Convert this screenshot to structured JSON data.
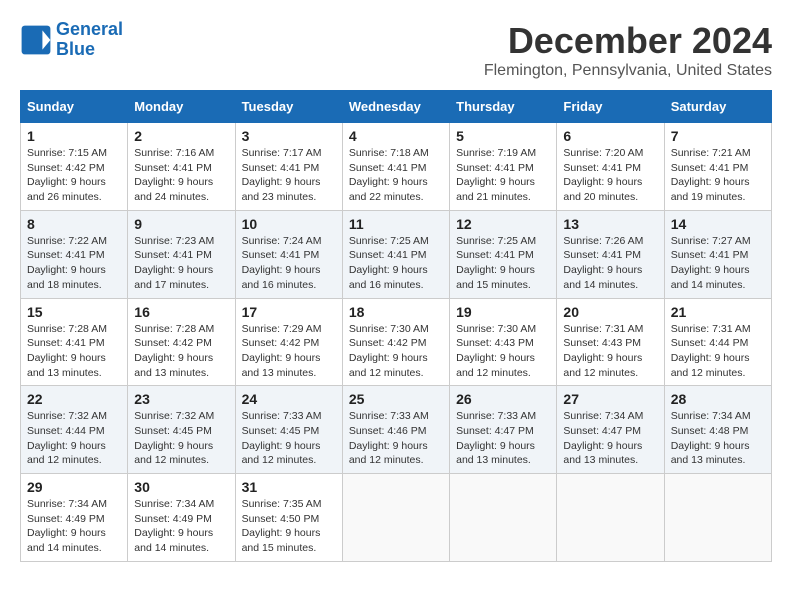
{
  "header": {
    "logo_line1": "General",
    "logo_line2": "Blue",
    "month_year": "December 2024",
    "location": "Flemington, Pennsylvania, United States"
  },
  "weekdays": [
    "Sunday",
    "Monday",
    "Tuesday",
    "Wednesday",
    "Thursday",
    "Friday",
    "Saturday"
  ],
  "weeks": [
    [
      {
        "day": "1",
        "sunrise": "Sunrise: 7:15 AM",
        "sunset": "Sunset: 4:42 PM",
        "daylight": "Daylight: 9 hours and 26 minutes."
      },
      {
        "day": "2",
        "sunrise": "Sunrise: 7:16 AM",
        "sunset": "Sunset: 4:41 PM",
        "daylight": "Daylight: 9 hours and 24 minutes."
      },
      {
        "day": "3",
        "sunrise": "Sunrise: 7:17 AM",
        "sunset": "Sunset: 4:41 PM",
        "daylight": "Daylight: 9 hours and 23 minutes."
      },
      {
        "day": "4",
        "sunrise": "Sunrise: 7:18 AM",
        "sunset": "Sunset: 4:41 PM",
        "daylight": "Daylight: 9 hours and 22 minutes."
      },
      {
        "day": "5",
        "sunrise": "Sunrise: 7:19 AM",
        "sunset": "Sunset: 4:41 PM",
        "daylight": "Daylight: 9 hours and 21 minutes."
      },
      {
        "day": "6",
        "sunrise": "Sunrise: 7:20 AM",
        "sunset": "Sunset: 4:41 PM",
        "daylight": "Daylight: 9 hours and 20 minutes."
      },
      {
        "day": "7",
        "sunrise": "Sunrise: 7:21 AM",
        "sunset": "Sunset: 4:41 PM",
        "daylight": "Daylight: 9 hours and 19 minutes."
      }
    ],
    [
      {
        "day": "8",
        "sunrise": "Sunrise: 7:22 AM",
        "sunset": "Sunset: 4:41 PM",
        "daylight": "Daylight: 9 hours and 18 minutes."
      },
      {
        "day": "9",
        "sunrise": "Sunrise: 7:23 AM",
        "sunset": "Sunset: 4:41 PM",
        "daylight": "Daylight: 9 hours and 17 minutes."
      },
      {
        "day": "10",
        "sunrise": "Sunrise: 7:24 AM",
        "sunset": "Sunset: 4:41 PM",
        "daylight": "Daylight: 9 hours and 16 minutes."
      },
      {
        "day": "11",
        "sunrise": "Sunrise: 7:25 AM",
        "sunset": "Sunset: 4:41 PM",
        "daylight": "Daylight: 9 hours and 16 minutes."
      },
      {
        "day": "12",
        "sunrise": "Sunrise: 7:25 AM",
        "sunset": "Sunset: 4:41 PM",
        "daylight": "Daylight: 9 hours and 15 minutes."
      },
      {
        "day": "13",
        "sunrise": "Sunrise: 7:26 AM",
        "sunset": "Sunset: 4:41 PM",
        "daylight": "Daylight: 9 hours and 14 minutes."
      },
      {
        "day": "14",
        "sunrise": "Sunrise: 7:27 AM",
        "sunset": "Sunset: 4:41 PM",
        "daylight": "Daylight: 9 hours and 14 minutes."
      }
    ],
    [
      {
        "day": "15",
        "sunrise": "Sunrise: 7:28 AM",
        "sunset": "Sunset: 4:41 PM",
        "daylight": "Daylight: 9 hours and 13 minutes."
      },
      {
        "day": "16",
        "sunrise": "Sunrise: 7:28 AM",
        "sunset": "Sunset: 4:42 PM",
        "daylight": "Daylight: 9 hours and 13 minutes."
      },
      {
        "day": "17",
        "sunrise": "Sunrise: 7:29 AM",
        "sunset": "Sunset: 4:42 PM",
        "daylight": "Daylight: 9 hours and 13 minutes."
      },
      {
        "day": "18",
        "sunrise": "Sunrise: 7:30 AM",
        "sunset": "Sunset: 4:42 PM",
        "daylight": "Daylight: 9 hours and 12 minutes."
      },
      {
        "day": "19",
        "sunrise": "Sunrise: 7:30 AM",
        "sunset": "Sunset: 4:43 PM",
        "daylight": "Daylight: 9 hours and 12 minutes."
      },
      {
        "day": "20",
        "sunrise": "Sunrise: 7:31 AM",
        "sunset": "Sunset: 4:43 PM",
        "daylight": "Daylight: 9 hours and 12 minutes."
      },
      {
        "day": "21",
        "sunrise": "Sunrise: 7:31 AM",
        "sunset": "Sunset: 4:44 PM",
        "daylight": "Daylight: 9 hours and 12 minutes."
      }
    ],
    [
      {
        "day": "22",
        "sunrise": "Sunrise: 7:32 AM",
        "sunset": "Sunset: 4:44 PM",
        "daylight": "Daylight: 9 hours and 12 minutes."
      },
      {
        "day": "23",
        "sunrise": "Sunrise: 7:32 AM",
        "sunset": "Sunset: 4:45 PM",
        "daylight": "Daylight: 9 hours and 12 minutes."
      },
      {
        "day": "24",
        "sunrise": "Sunrise: 7:33 AM",
        "sunset": "Sunset: 4:45 PM",
        "daylight": "Daylight: 9 hours and 12 minutes."
      },
      {
        "day": "25",
        "sunrise": "Sunrise: 7:33 AM",
        "sunset": "Sunset: 4:46 PM",
        "daylight": "Daylight: 9 hours and 12 minutes."
      },
      {
        "day": "26",
        "sunrise": "Sunrise: 7:33 AM",
        "sunset": "Sunset: 4:47 PM",
        "daylight": "Daylight: 9 hours and 13 minutes."
      },
      {
        "day": "27",
        "sunrise": "Sunrise: 7:34 AM",
        "sunset": "Sunset: 4:47 PM",
        "daylight": "Daylight: 9 hours and 13 minutes."
      },
      {
        "day": "28",
        "sunrise": "Sunrise: 7:34 AM",
        "sunset": "Sunset: 4:48 PM",
        "daylight": "Daylight: 9 hours and 13 minutes."
      }
    ],
    [
      {
        "day": "29",
        "sunrise": "Sunrise: 7:34 AM",
        "sunset": "Sunset: 4:49 PM",
        "daylight": "Daylight: 9 hours and 14 minutes."
      },
      {
        "day": "30",
        "sunrise": "Sunrise: 7:34 AM",
        "sunset": "Sunset: 4:49 PM",
        "daylight": "Daylight: 9 hours and 14 minutes."
      },
      {
        "day": "31",
        "sunrise": "Sunrise: 7:35 AM",
        "sunset": "Sunset: 4:50 PM",
        "daylight": "Daylight: 9 hours and 15 minutes."
      },
      null,
      null,
      null,
      null
    ]
  ]
}
